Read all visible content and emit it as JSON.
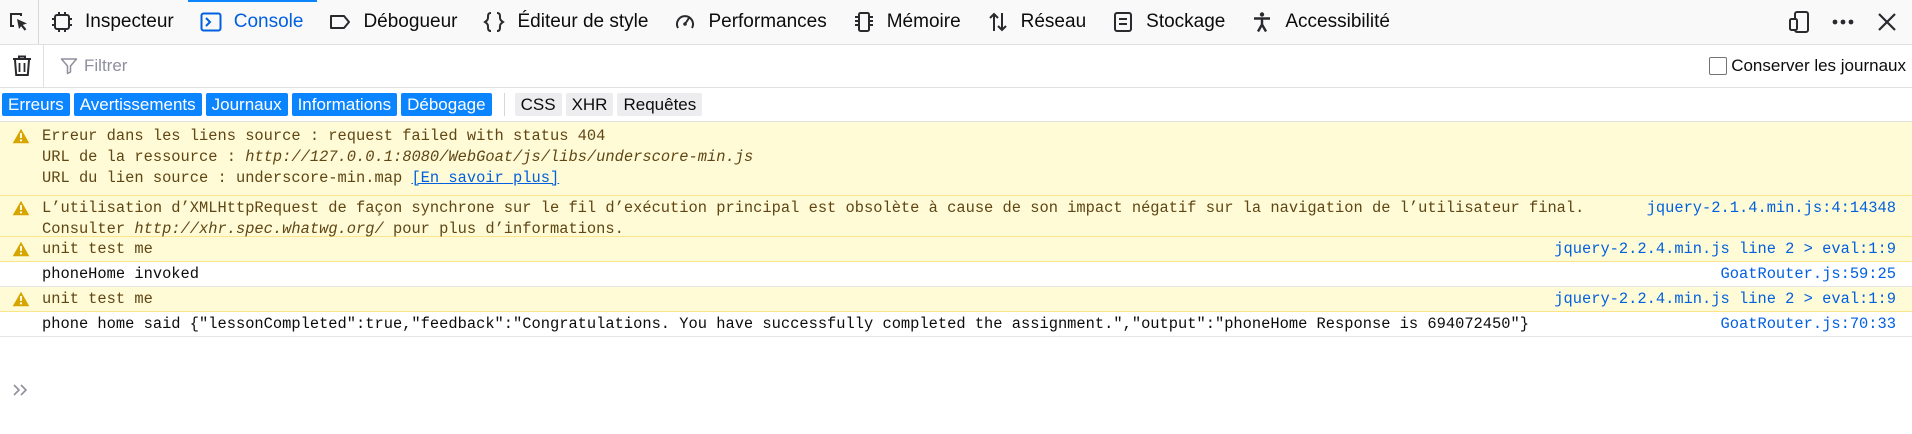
{
  "toolbar": {
    "tabs": [
      {
        "label": "Inspecteur",
        "icon": "inspector-icon"
      },
      {
        "label": "Console",
        "icon": "console-icon"
      },
      {
        "label": "Débogueur",
        "icon": "debugger-icon"
      },
      {
        "label": "Éditeur de style",
        "icon": "style-editor-icon"
      },
      {
        "label": "Performances",
        "icon": "performance-icon"
      },
      {
        "label": "Mémoire",
        "icon": "memory-icon"
      },
      {
        "label": "Réseau",
        "icon": "network-icon"
      },
      {
        "label": "Stockage",
        "icon": "storage-icon"
      },
      {
        "label": "Accessibilité",
        "icon": "accessibility-icon"
      }
    ],
    "selected": "Console"
  },
  "filterbar": {
    "placeholder": "Filtrer",
    "persist_label": "Conserver les journaux"
  },
  "categories": {
    "errors": "Erreurs",
    "warnings": "Avertissements",
    "logs": "Journaux",
    "info": "Informations",
    "debug": "Débogage",
    "css": "CSS",
    "xhr": "XHR",
    "requests": "Requêtes"
  },
  "messages": {
    "m1": {
      "line1": "Erreur dans les liens source : request failed with status 404",
      "line2_label": "URL de la ressource : ",
      "line2_url": "http://127.0.0.1:8080/WebGoat/js/libs/underscore-min.js",
      "line3_label": "URL du lien source : underscore-min.map ",
      "line3_link": "[En savoir plus]"
    },
    "m2": {
      "line1": "L’utilisation d’XMLHttpRequest de façon synchrone sur le fil d’exécution principal est obsolète à cause de son impact négatif sur la navigation de l’utilisateur final.",
      "line2_a": "Consulter ",
      "line2_url": "http://xhr.spec.whatwg.org/",
      "line2_b": " pour plus d’informations.",
      "location": "jquery-2.1.4.min.js:4:14348"
    },
    "m3": {
      "text": "unit test me",
      "location": "jquery-2.2.4.min.js line 2 > eval:1:9"
    },
    "m4": {
      "text": "phoneHome invoked",
      "location": "GoatRouter.js:59:25"
    },
    "m5": {
      "text": "unit test me",
      "location": "jquery-2.2.4.min.js line 2 > eval:1:9"
    },
    "m6": {
      "text": "phone home said {\"lessonCompleted\":true,\"feedback\":\"Congratulations. You have successfully completed the assignment.\",\"output\":\"phoneHome Response is 694072450\"}",
      "location": "GoatRouter.js:70:33"
    }
  },
  "colors": {
    "accent": "#0a84ff",
    "warning_bg": "#fffbd6",
    "warning_text": "#5f4615",
    "link": "#0060df"
  }
}
